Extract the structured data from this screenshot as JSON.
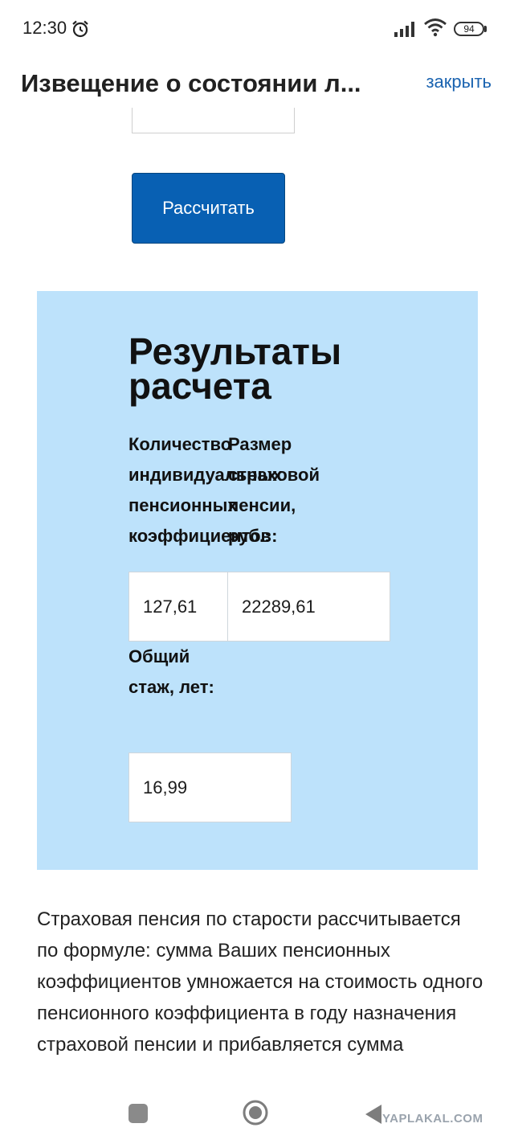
{
  "status_bar": {
    "time": "12:30",
    "battery": "94"
  },
  "header": {
    "title": "Извещение о состоянии л...",
    "close_label": "закрыть"
  },
  "calc_button_label": "Рассчитать",
  "results": {
    "title": "Результаты расчета",
    "ipk_label": "Количество индивидуальных пенсионных коэффициентов:",
    "size_label": "Размер страховой пенсии, руб.:",
    "ipk_value": "127,61",
    "size_value": "22289,61",
    "stazh_label": "Общий стаж, лет:",
    "stazh_value": "16,99"
  },
  "description": "Страховая пенсия по старости рассчитывается по формуле: сумма Ваших пенсионных коэффициентов умножается на стоимость одного пенсионного коэффициента в году назначения страховой пенсии и прибавляется сумма",
  "watermark": "YAPLAKAL.COM",
  "icons": {
    "alarm": "alarm-clock-icon",
    "signal": "cellular-signal-icon",
    "wifi": "wifi-icon",
    "nav_recent": "square-icon",
    "nav_home": "circle-icon",
    "nav_back": "triangle-back-icon"
  },
  "colors": {
    "accent": "#0860b3",
    "link": "#1a63b0",
    "panel": "#bde2fb"
  }
}
